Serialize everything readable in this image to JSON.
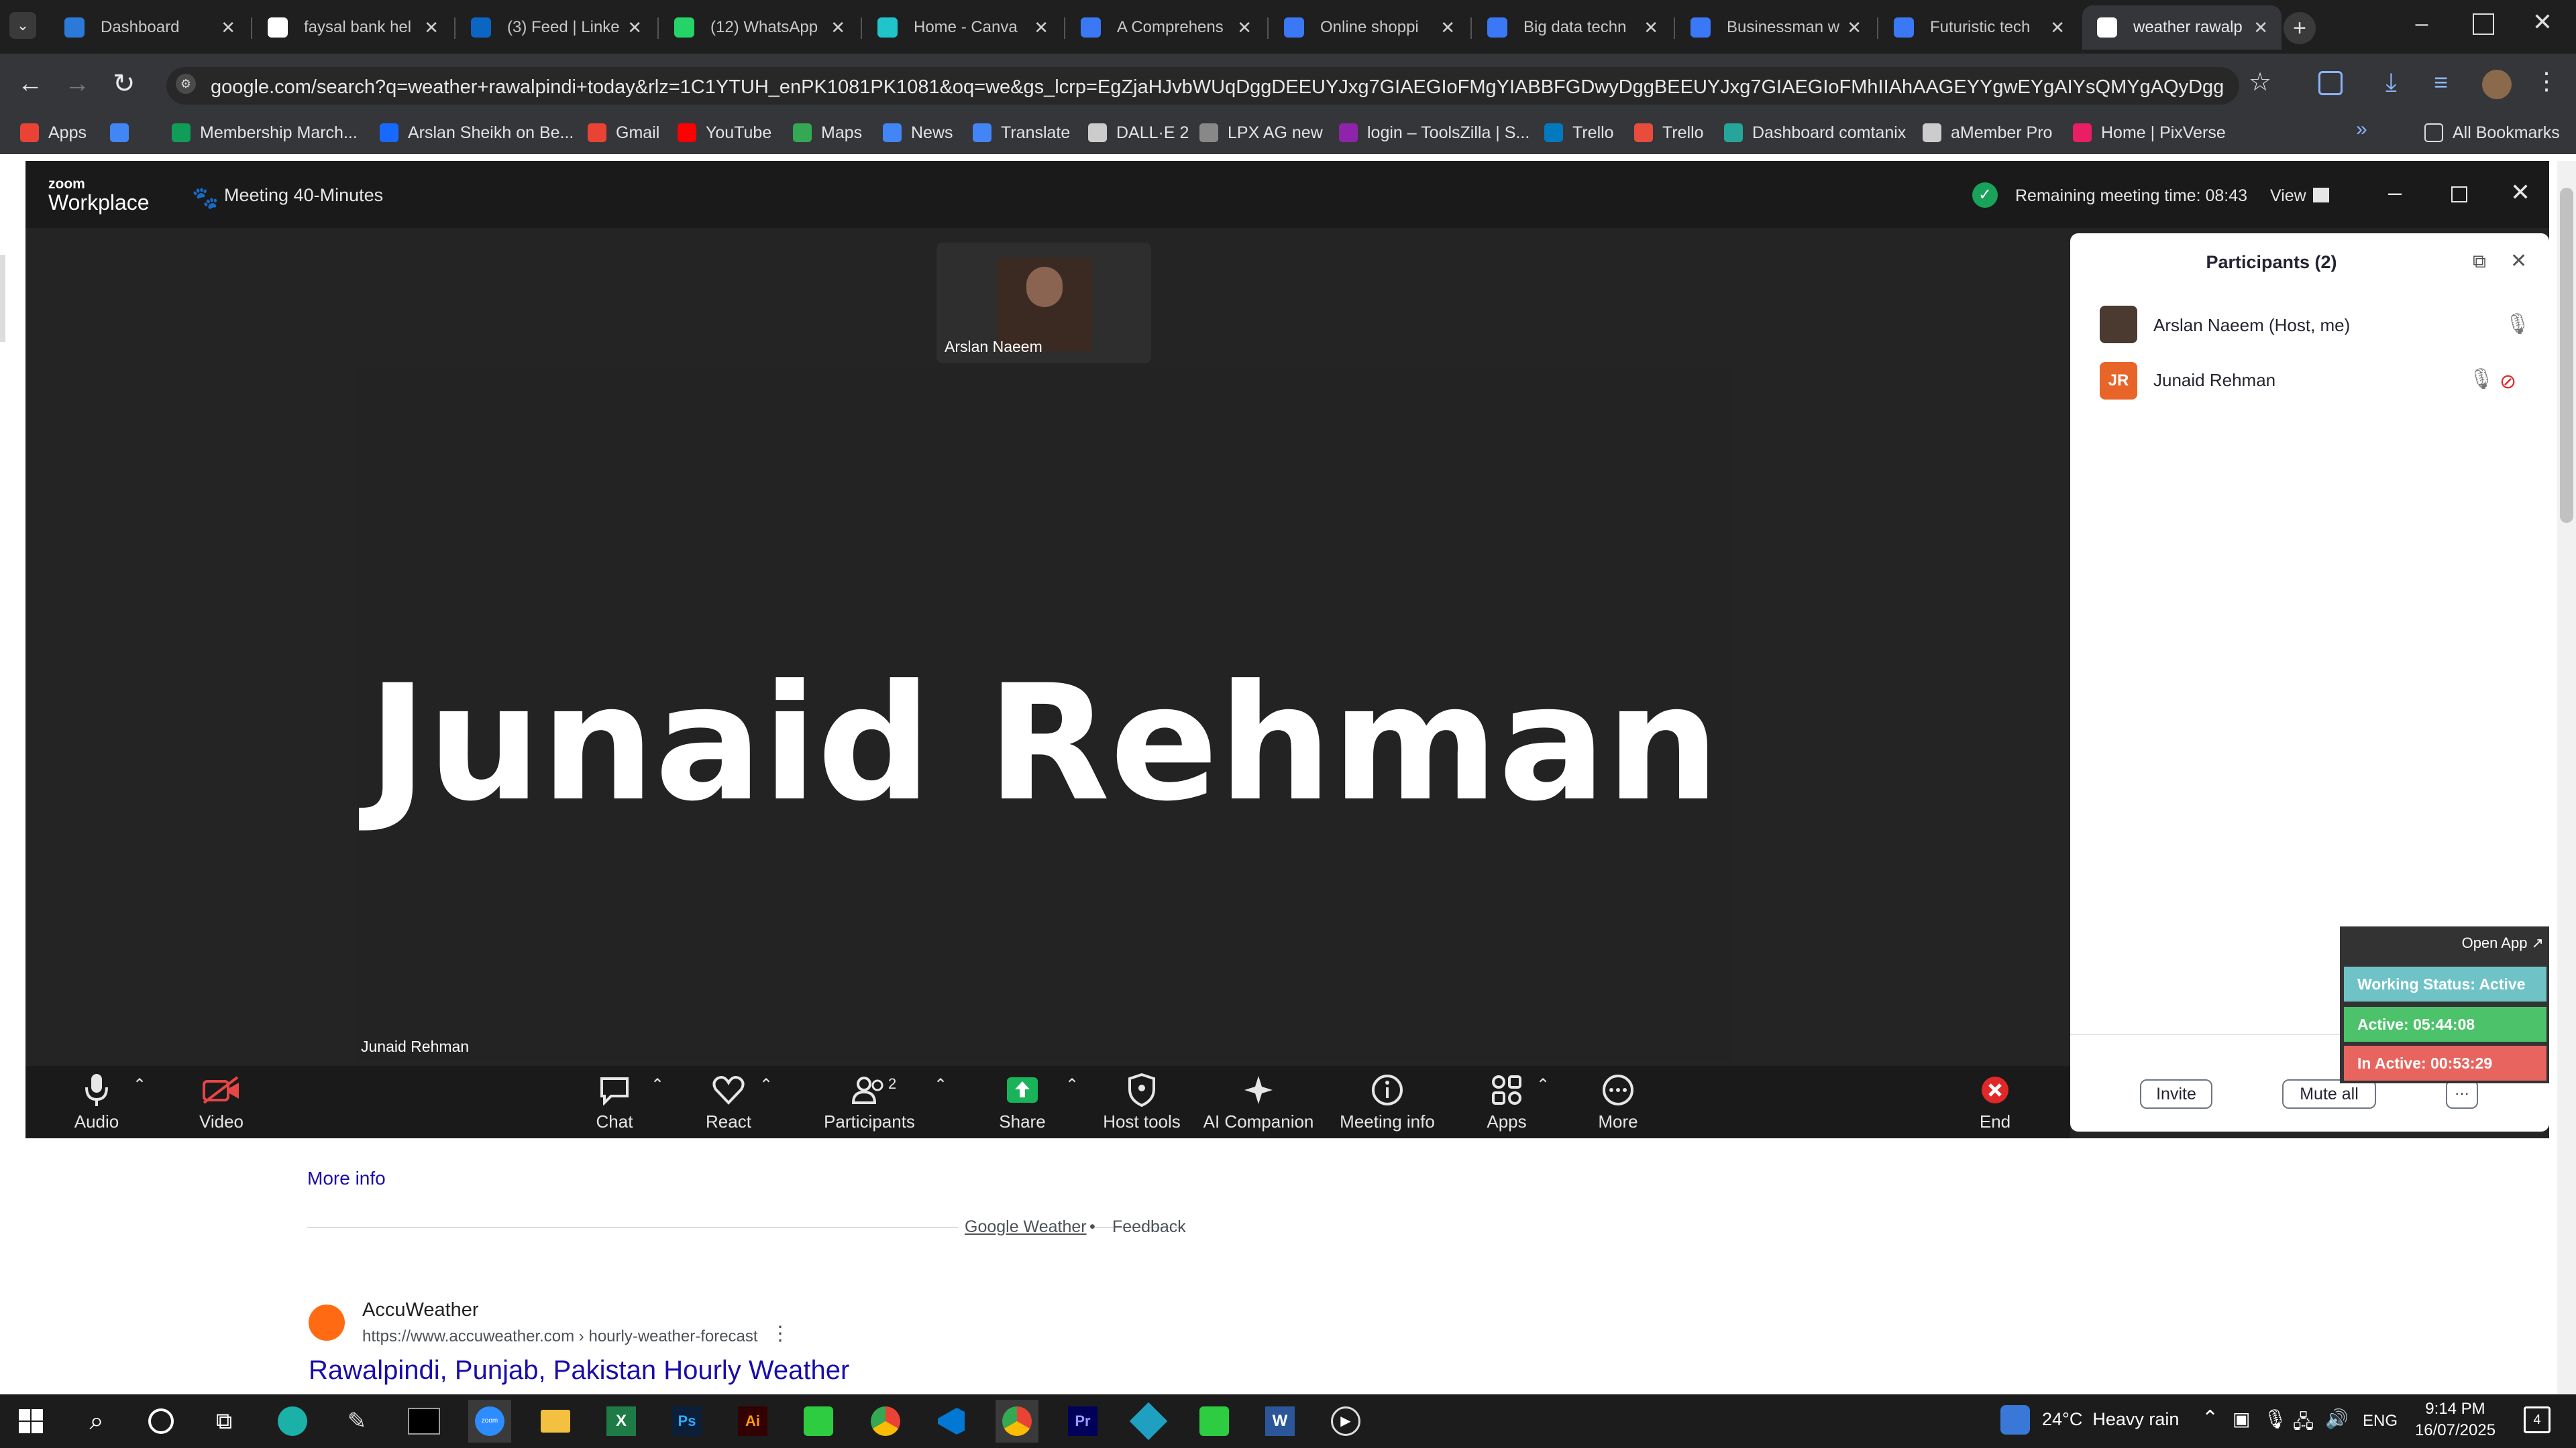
{
  "browser": {
    "tabs": [
      {
        "label": "Dashboard",
        "icon": "settings-globe-icon",
        "color": "#2b79d9"
      },
      {
        "label": "faysal bank hel",
        "icon": "google-icon",
        "color": "#ffffff"
      },
      {
        "label": "(3) Feed | Linke",
        "icon": "linkedin-icon",
        "color": "#0a66c2"
      },
      {
        "label": "(12) WhatsApp",
        "icon": "whatsapp-icon",
        "color": "#25d366"
      },
      {
        "label": "Home - Canva",
        "icon": "canva-icon",
        "color": "#20c4cb"
      },
      {
        "label": "A Comprehens",
        "icon": "docs-icon",
        "color": "#3b78f6"
      },
      {
        "label": "Online shoppi",
        "icon": "docs-icon",
        "color": "#3b78f6"
      },
      {
        "label": "Big data techn",
        "icon": "docs-icon",
        "color": "#3b78f6"
      },
      {
        "label": "Businessman w",
        "icon": "docs-icon",
        "color": "#3b78f6"
      },
      {
        "label": "Futuristic tech",
        "icon": "docs-icon",
        "color": "#3b78f6"
      },
      {
        "label": "weather rawalp",
        "icon": "google-icon",
        "color": "#ffffff"
      }
    ],
    "url": "google.com/search?q=weather+rawalpindi+today&rlz=1C1YTUH_enPK1081PK1081&oq=we&gs_lcrp=EgZjaHJvbWUqDggDEEUYJxg7GIAEGIoFMgYIABBFGDwyDggBEEUYJxg7GIAEGIoFMhIIAhAAGEYYgwEYgAIYsQMYgAQyDggDEEUYJxg7GIAEGIi...",
    "bookmarks": [
      {
        "label": "Apps",
        "icon": "apps-grid-icon",
        "color": "#ea4335"
      },
      {
        "label": "",
        "icon": "apps-grid-blue-icon",
        "color": "#4285f4"
      },
      {
        "label": "Membership March...",
        "icon": "sheets-icon",
        "color": "#0f9d58"
      },
      {
        "label": "Arslan Sheikh on Be...",
        "icon": "behance-icon",
        "color": "#1769ff"
      },
      {
        "label": "Gmail",
        "icon": "gmail-icon",
        "color": "#ea4335"
      },
      {
        "label": "YouTube",
        "icon": "youtube-icon",
        "color": "#ff0000"
      },
      {
        "label": "Maps",
        "icon": "maps-icon",
        "color": "#34a853"
      },
      {
        "label": "News",
        "icon": "news-icon",
        "color": "#4285f4"
      },
      {
        "label": "Translate",
        "icon": "translate-icon",
        "color": "#4285f4"
      },
      {
        "label": "DALL·E 2",
        "icon": "openai-icon",
        "color": "#cccccc"
      },
      {
        "label": "LPX AG new",
        "icon": "dots-icon",
        "color": "#888888"
      },
      {
        "label": "login – ToolsZilla | S...",
        "icon": "toolszilla-icon",
        "color": "#8e24aa"
      },
      {
        "label": "Trello",
        "icon": "trello-icon",
        "color": "#0079bf"
      },
      {
        "label": "Trello",
        "icon": "trello-alt-icon",
        "color": "#e74c3c"
      },
      {
        "label": "Dashboard comtanix",
        "icon": "globe-gear-icon",
        "color": "#26a69a"
      },
      {
        "label": "aMember Pro",
        "icon": "globe-icon",
        "color": "#cccccc"
      },
      {
        "label": "Home | PixVerse",
        "icon": "pixverse-icon",
        "color": "#e91e63"
      }
    ],
    "all_bookmarks": "All Bookmarks"
  },
  "zoom": {
    "brand_top": "zoom",
    "brand_bottom": "Workplace",
    "meeting_title": "Meeting 40-Minutes",
    "remaining": "Remaining meeting time: 08:43",
    "view": "View",
    "self_name": "Arslan Naeem",
    "main_name": "Junaid Rehman",
    "main_label": "Junaid Rehman",
    "toolbar": {
      "audio": "Audio",
      "video": "Video",
      "chat": "Chat",
      "react": "React",
      "participants": "Participants",
      "participants_count": "2",
      "share": "Share",
      "host_tools": "Host tools",
      "ai": "AI Companion",
      "meeting_info": "Meeting info",
      "apps": "Apps",
      "more": "More",
      "end": "End"
    },
    "panel": {
      "title": "Participants (2)",
      "participants": [
        {
          "name": "Arslan Naeem (Host, me)",
          "initials": ""
        },
        {
          "name": "Junaid Rehman",
          "initials": "JR"
        }
      ],
      "invite": "Invite",
      "mute_all": "Mute all",
      "more": "···"
    },
    "widget": {
      "open_app": "Open App ↗",
      "working": "Working Status: Active",
      "active": "Active: 05:44:08",
      "inactive": "In Active: 00:53:29"
    }
  },
  "google": {
    "more_info": "More info",
    "google_weather": "Google Weather",
    "feedback": "Feedback",
    "result_site": "AccuWeather",
    "result_url": "https://www.accuweather.com › hourly-weather-forecast",
    "result_title": "Rawalpindi, Punjab, Pakistan Hourly Weather"
  },
  "taskbar": {
    "weather": "24°C  Heavy rain",
    "lang": "ENG",
    "time": "9:14 PM",
    "date": "16/07/2025",
    "notif_count": "4"
  }
}
